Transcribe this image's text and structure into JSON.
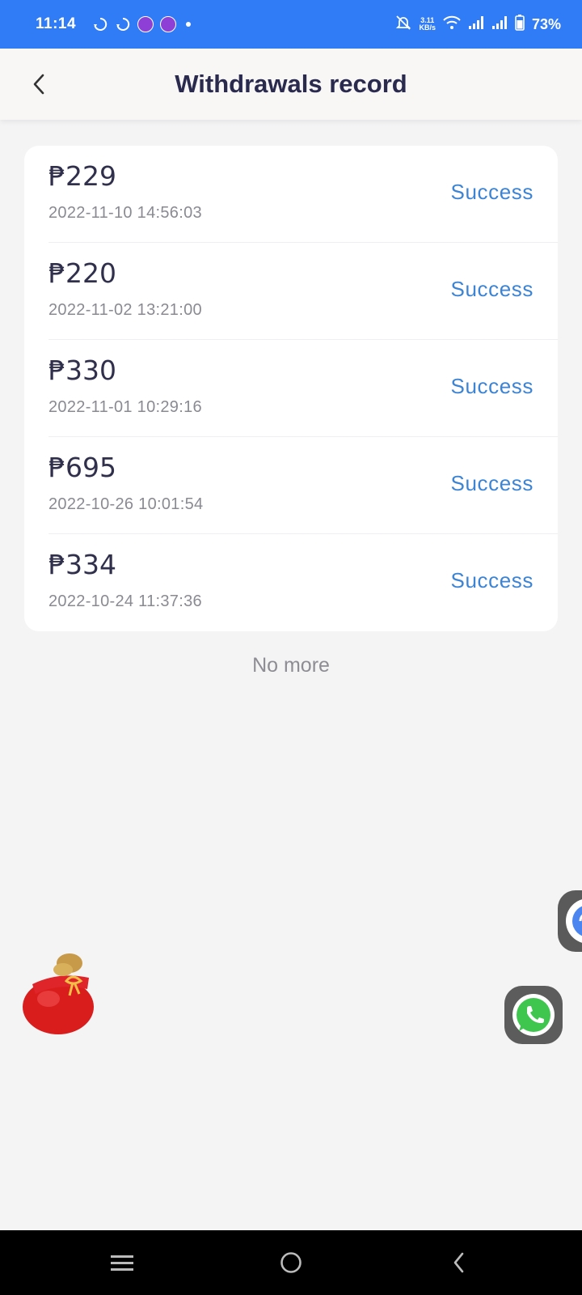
{
  "status_bar": {
    "time": "11:14",
    "speed_value": "3.11",
    "speed_unit": "KB/s",
    "battery": "73%",
    "icons": [
      "sync-icon",
      "sync-icon",
      "app-badge-icon",
      "app-badge-icon",
      "notification-dot",
      "mute-icon",
      "wifi-icon",
      "signal-icon",
      "signal-icon",
      "battery-icon"
    ]
  },
  "header": {
    "title": "Withdrawals record",
    "back_icon": "chevron-left-icon"
  },
  "records": [
    {
      "amount": "₱229",
      "datetime": "2022-11-10 14:56:03",
      "status": "Success"
    },
    {
      "amount": "₱220",
      "datetime": "2022-11-02 13:21:00",
      "status": "Success"
    },
    {
      "amount": "₱330",
      "datetime": "2022-11-01 10:29:16",
      "status": "Success"
    },
    {
      "amount": "₱695",
      "datetime": "2022-10-26 10:01:54",
      "status": "Success"
    },
    {
      "amount": "₱334",
      "datetime": "2022-10-24 11:37:36",
      "status": "Success"
    }
  ],
  "footer_text": "No more",
  "floating": {
    "bag": "lucky-bag-icon",
    "chat": "chat-support-icon",
    "whatsapp": "whatsapp-icon"
  },
  "nav_bar": {
    "icons": [
      "menu-icon",
      "home-icon",
      "back-icon"
    ]
  },
  "colors": {
    "status_bar": "#2f7cf6",
    "success_text": "#3d84d4",
    "title_text": "#2a2a4f",
    "page_background": "#f4f4f5"
  }
}
